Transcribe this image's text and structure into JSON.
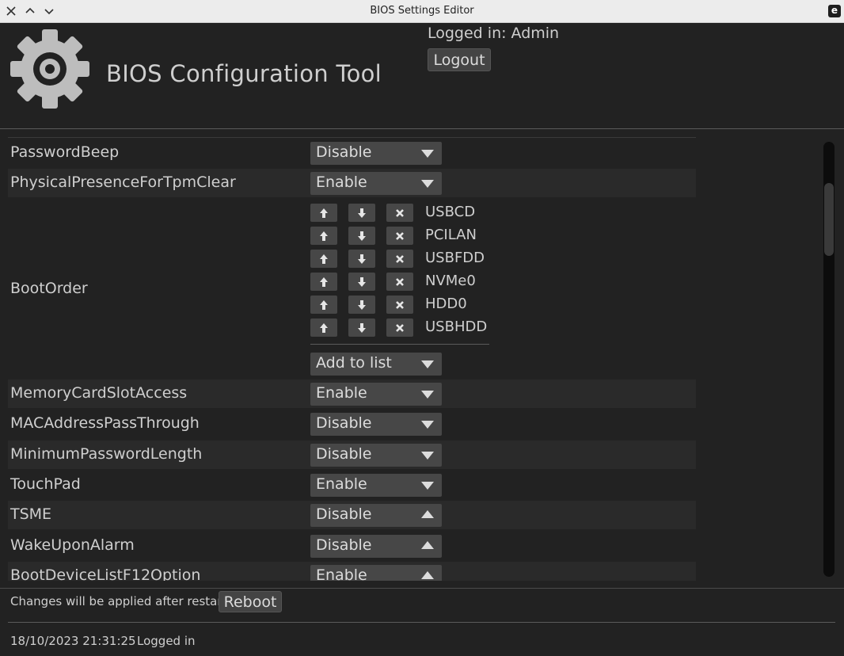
{
  "window": {
    "title": "BIOS Settings Editor",
    "app_badge": "e"
  },
  "header": {
    "app_title": "BIOS Configuration Tool",
    "logged_in_text": "Logged in: Admin",
    "logout_label": "Logout"
  },
  "settings": [
    {
      "name": "PasswordBeep",
      "value": "Disable",
      "arrow": "down"
    },
    {
      "name": "PhysicalPresenceForTpmClear",
      "value": "Enable",
      "arrow": "down"
    },
    {
      "name": "MemoryCardSlotAccess",
      "value": "Enable",
      "arrow": "down"
    },
    {
      "name": "MACAddressPassThrough",
      "value": "Disable",
      "arrow": "down"
    },
    {
      "name": "MinimumPasswordLength",
      "value": "Disable",
      "arrow": "down"
    },
    {
      "name": "TouchPad",
      "value": "Enable",
      "arrow": "down"
    },
    {
      "name": "TSME",
      "value": "Disable",
      "arrow": "up"
    },
    {
      "name": "WakeUponAlarm",
      "value": "Disable",
      "arrow": "up"
    },
    {
      "name": "BootDeviceListF12Option",
      "value": "Enable",
      "arrow": "up"
    }
  ],
  "boot_order": {
    "label": "BootOrder",
    "items": [
      "USBCD",
      "PCILAN",
      "USBFDD",
      "NVMe0",
      "HDD0",
      "USBHDD"
    ],
    "add_label": "Add to list"
  },
  "footer": {
    "restart_note": "Changes will be applied after restart.",
    "reboot_label": "Reboot"
  },
  "status_bar": {
    "timestamp": "18/10/2023 21:31:25",
    "status": "Logged in"
  },
  "icons": {
    "gear": "gear-icon",
    "move_up": "arrow-up-icon",
    "move_down": "arrow-down-icon",
    "remove": "close-icon"
  }
}
